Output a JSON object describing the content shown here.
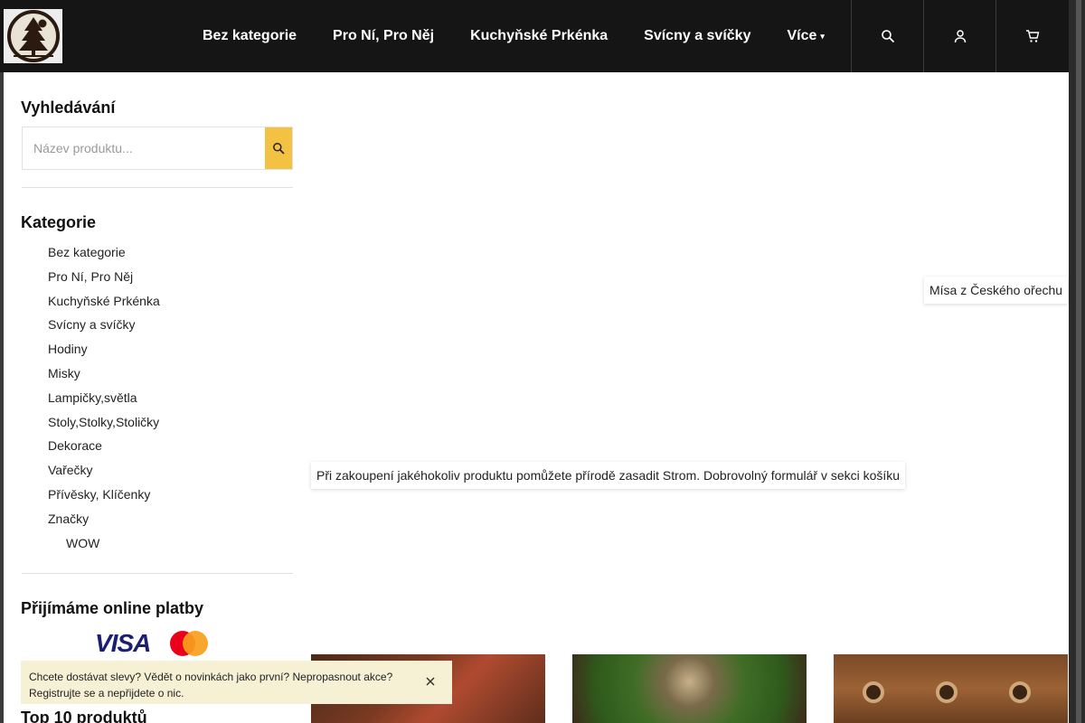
{
  "header": {
    "logo_name": "tree-logo",
    "nav": [
      {
        "label": "Bez kategorie"
      },
      {
        "label": "Pro Ní, Pro Něj"
      },
      {
        "label": "Kuchyňské Prkénka"
      },
      {
        "label": "Svícny a svíčky"
      },
      {
        "label": "Více"
      }
    ],
    "more_caret": "",
    "icons": [
      "search-icon",
      "user-icon",
      "cart-icon"
    ]
  },
  "sidebar": {
    "search": {
      "title": "Vyhledávání",
      "placeholder": "Název produktu..."
    },
    "categories": {
      "title": "Kategorie",
      "items": [
        {
          "label": "Bez kategorie"
        },
        {
          "label": "Pro Ní, Pro Něj"
        },
        {
          "label": "Kuchyňské Prkénka"
        },
        {
          "label": "Svícny a svíčky"
        },
        {
          "label": "Hodiny"
        },
        {
          "label": "Misky"
        },
        {
          "label": "Lampičky,světla"
        },
        {
          "label": "Stoly,Stolky,Stoličky"
        },
        {
          "label": "Dekorace"
        },
        {
          "label": "Vařečky"
        },
        {
          "label": "Přívěsky, Klíčenky"
        },
        {
          "label": "Značky"
        },
        {
          "label": "WOW"
        }
      ]
    },
    "payments": {
      "title": "Přijímáme online platby",
      "visa": "VISA",
      "mastercard": "mastercard-logo"
    },
    "top10": {
      "title": "Top 10 produktů"
    }
  },
  "main": {
    "banner_label_1": "Mísa z Českého ořechu",
    "banner_label_2": "Při zakoupení jakéhokoliv produktu pomůžete přírodě zasadit Strom. Dobrovolný formulář v sekci košíku"
  },
  "newsletter": {
    "text_line_1": "Chcete dostávat slevy? Vědět o novinkách jako první? Nepropasnout akce?",
    "text_line_2": "Registrujte se a nepřijdete o nic."
  },
  "colors": {
    "header_bg": "#151515",
    "accent": "#f3c242",
    "newsletter_bg": "#f6f0d4"
  }
}
